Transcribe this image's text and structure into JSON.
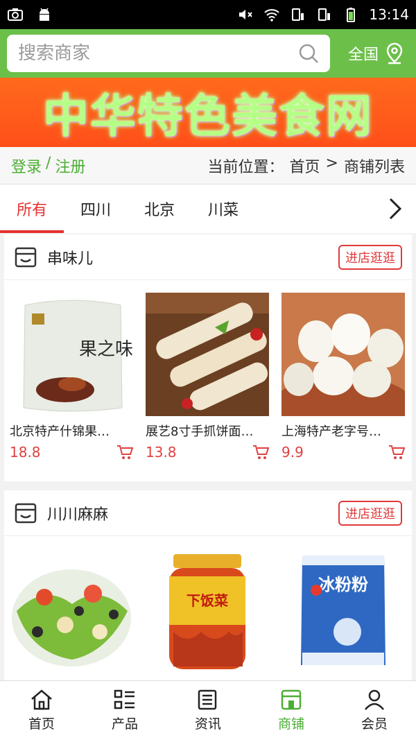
{
  "status_bar": {
    "time": "13:14"
  },
  "search": {
    "placeholder": "搜索商家",
    "region_label": "全国"
  },
  "banner": {
    "title": "中华特色美食网"
  },
  "auth": {
    "login": "登录",
    "separator": "/",
    "register": "注册"
  },
  "breadcrumb": {
    "prefix": "当前位置：",
    "home": "首页",
    "separator": ">",
    "current": "商铺列表"
  },
  "tabs": [
    {
      "label": "所有",
      "active": true
    },
    {
      "label": "四川",
      "active": false
    },
    {
      "label": "北京",
      "active": false
    },
    {
      "label": "川菜",
      "active": false
    }
  ],
  "shops": [
    {
      "name": "串味儿",
      "visit_label": "进店逛逛",
      "products": [
        {
          "name": "北京特产什锦果…",
          "price": "18.8",
          "image": "packaged-snack-bag"
        },
        {
          "name": "展艺8寸手抓饼面…",
          "price": "13.8",
          "image": "tortilla-wraps"
        },
        {
          "name": "上海特产老字号…",
          "price": "9.9",
          "image": "white-radish-pieces"
        }
      ]
    },
    {
      "name": "川川麻麻",
      "visit_label": "进店逛逛",
      "products": [
        {
          "name": "",
          "price": "",
          "image": "salad-plate"
        },
        {
          "name": "",
          "price": "",
          "image": "pickled-vegetable-jar"
        },
        {
          "name": "",
          "price": "",
          "image": "ice-jelly-powder-pack"
        }
      ]
    }
  ],
  "bottom_nav": [
    {
      "label": "首页",
      "icon": "home-icon",
      "active": false
    },
    {
      "label": "产品",
      "icon": "grid-list-icon",
      "active": false
    },
    {
      "label": "资讯",
      "icon": "news-icon",
      "active": false
    },
    {
      "label": "商铺",
      "icon": "store-icon",
      "active": true
    },
    {
      "label": "会员",
      "icon": "user-icon",
      "active": false
    }
  ],
  "colors": {
    "brand_green": "#6cc04a",
    "accent_red": "#e53030",
    "banner_orange": "#ff5a1c"
  }
}
